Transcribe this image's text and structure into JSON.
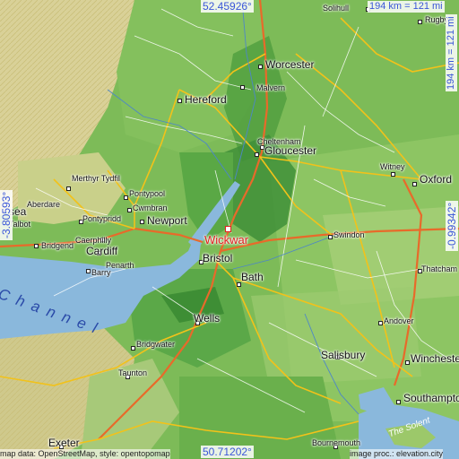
{
  "map": {
    "target": {
      "name": "Wickwar",
      "color": "#e02020"
    },
    "coordinates": {
      "north": "52.45926°",
      "south": "50.71202°",
      "west": "-3.80593°",
      "east": "-0.99342°"
    },
    "scale": {
      "top": "194 km = 121 mi",
      "right": "194 km = 121 mi"
    },
    "attribution": {
      "left": "map data: OpenStreetMap, style: opentopomap",
      "right": "image proc.: elevation.city"
    },
    "water_labels": {
      "channel": "C h a n n e l",
      "solent": "The Solent"
    },
    "places": [
      {
        "name": "Solihull",
        "size": "small"
      },
      {
        "name": "Rugby",
        "size": "small"
      },
      {
        "name": "Worcester",
        "size": "big"
      },
      {
        "name": "Malvern",
        "size": "small"
      },
      {
        "name": "Hereford",
        "size": "big"
      },
      {
        "name": "Cheltenham",
        "size": "small"
      },
      {
        "name": "Gloucester",
        "size": "big"
      },
      {
        "name": "Witney",
        "size": "small"
      },
      {
        "name": "Oxford",
        "size": "big"
      },
      {
        "name": "Merthyr Tydfil",
        "size": "small"
      },
      {
        "name": "Aberdare",
        "size": "small"
      },
      {
        "name": "Pontypool",
        "size": "small"
      },
      {
        "name": "Cwmbran",
        "size": "small"
      },
      {
        "name": "Newport",
        "size": "big"
      },
      {
        "name": "Pontypridd",
        "size": "small"
      },
      {
        "name": "Caerphilly",
        "size": "small"
      },
      {
        "name": "Bridgend",
        "size": "small"
      },
      {
        "name": "Cardiff",
        "size": "big"
      },
      {
        "name": "Penarth",
        "size": "small"
      },
      {
        "name": "Barry",
        "size": "small"
      },
      {
        "name": "Talbot",
        "size": "small"
      },
      {
        "name": "sea",
        "size": "big"
      },
      {
        "name": "Swindon",
        "size": "small"
      },
      {
        "name": "Bristol",
        "size": "big"
      },
      {
        "name": "Bath",
        "size": "big"
      },
      {
        "name": "Thatcham",
        "size": "small"
      },
      {
        "name": "Wells",
        "size": "big"
      },
      {
        "name": "Andover",
        "size": "small"
      },
      {
        "name": "Bridgwater",
        "size": "small"
      },
      {
        "name": "Winchester",
        "size": "big"
      },
      {
        "name": "Salisbury",
        "size": "big"
      },
      {
        "name": "Taunton",
        "size": "small"
      },
      {
        "name": "Southampton",
        "size": "big"
      },
      {
        "name": "Exeter",
        "size": "big"
      },
      {
        "name": "Bournemouth",
        "size": "small"
      }
    ],
    "colors": {
      "sea": "#8ab8dc",
      "lowland": "#6fb04e",
      "hill": "#9cc86a",
      "upland": "#d8cf8e",
      "road_major": "#f2c21a",
      "road_minor": "#ffffff",
      "motorway": "#e86a2a"
    }
  }
}
